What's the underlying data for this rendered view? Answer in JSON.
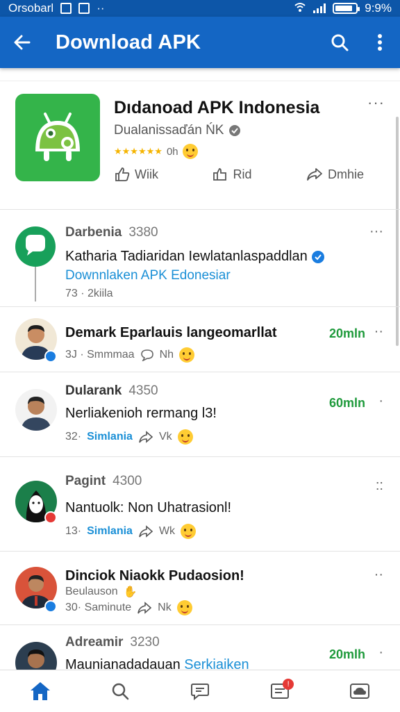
{
  "statusbar": {
    "carrier": "Orsobarl",
    "signal_label": "≈",
    "time": "9:9%"
  },
  "appbar": {
    "title": "Download APK"
  },
  "app_card": {
    "title": "Dıdanoad APK Indonesia",
    "subtitle": "Dualanissaďán ŃK",
    "rating_count": "0h",
    "rating_value": 5,
    "actions": [
      {
        "label": "Wiik"
      },
      {
        "label": "Rid"
      },
      {
        "label": "Dmhie"
      }
    ]
  },
  "posts": [
    {
      "name": "Darbenia",
      "num": "3380",
      "text": "Katharia Tadiaridan Iewlatanlaspaddlan",
      "link": "Downnlaken APK Edonesiar",
      "meta": "73 · 2kiila"
    },
    {
      "name": "",
      "num": "",
      "text": "Demark Eparlauis langeomarllat",
      "time": "20mln",
      "meta_a": "3J · Smmmaa",
      "meta_b": "Nh"
    },
    {
      "name": "Dularank",
      "num": "4350",
      "text": "Nerliakenioh rermang l3!",
      "time": "60mln",
      "meta_a": "32·",
      "meta_link": "Simlania",
      "meta_b": "Vk"
    },
    {
      "name": "Pagint",
      "num": "4300",
      "text": "Nantuolk: Non Uhatrasionl!",
      "meta_a": "13·",
      "meta_link": "Simlania",
      "meta_b": "Wk"
    },
    {
      "name": "",
      "num": "",
      "text": "Dinciok Niaokk Pudaosion!",
      "sub": "Beulauson",
      "meta_a": "30· Saminute",
      "meta_b": "Nk"
    },
    {
      "name": "Adreamir",
      "num": "3230",
      "text": "Maunianadadauan",
      "link_inline": "Serkiaiken",
      "time": "20mlh"
    }
  ],
  "colors": {
    "appbar": "#1466c4",
    "statusbar": "#0d56a8",
    "accent_green": "#1e9a3b",
    "link_blue": "#1a8fd6"
  }
}
